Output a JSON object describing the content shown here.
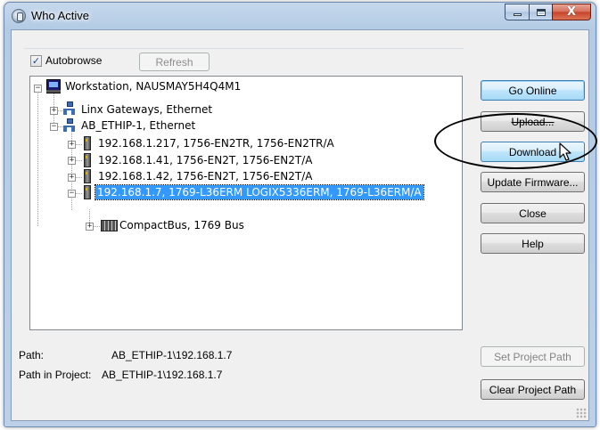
{
  "window": {
    "title": "Who Active",
    "min_label": "",
    "max_label": "",
    "close_label": "X"
  },
  "controls": {
    "autobrowse_label": "Autobrowse",
    "autobrowse_checked": true,
    "check_glyph": "✓",
    "refresh_label": "Refresh"
  },
  "tree": {
    "nodes": [
      {
        "label": "Workstation, NAUSMAY5H4Q4M1",
        "icon": "workstation-icon",
        "expanded": true
      },
      {
        "label": "Linx Gateways, Ethernet",
        "icon": "network-icon",
        "expanded": false
      },
      {
        "label": "AB_ETHIP-1, Ethernet",
        "icon": "network-icon",
        "expanded": true
      },
      {
        "label": "192.168.1.217, 1756-EN2TR, 1756-EN2TR/A",
        "icon": "module-icon",
        "expanded": false
      },
      {
        "label": "192.168.1.41, 1756-EN2T, 1756-EN2T/A",
        "icon": "module-icon",
        "expanded": false
      },
      {
        "label": "192.168.1.42, 1756-EN2T, 1756-EN2T/A",
        "icon": "module-icon",
        "expanded": false
      },
      {
        "label": "192.168.1.7, 1769-L36ERM LOGIX5336ERM, 1769-L36ERM/A",
        "icon": "module-icon",
        "expanded": true,
        "selected": true
      },
      {
        "label": "CompactBus, 1769 Bus",
        "icon": "bus-icon",
        "expanded": false
      }
    ],
    "expand_glyph": "+",
    "collapse_glyph": "−"
  },
  "buttons": {
    "go_online": "Go Online",
    "upload": "Upload...",
    "download": "Download",
    "update_firmware": "Update Firmware...",
    "close": "Close",
    "help": "Help",
    "set_project_path": "Set Project Path",
    "clear_project_path": "Clear Project Path"
  },
  "path_info": {
    "path_label": "Path:",
    "path_value": "AB_ETHIP-1\\192.168.1.7",
    "project_label": "Path in Project:",
    "project_value": "AB_ETHIP-1\\192.168.1.7"
  },
  "colors": {
    "selection": "#3399ff",
    "title_bar": "#b9cfe7",
    "close_button": "#c7432a"
  }
}
